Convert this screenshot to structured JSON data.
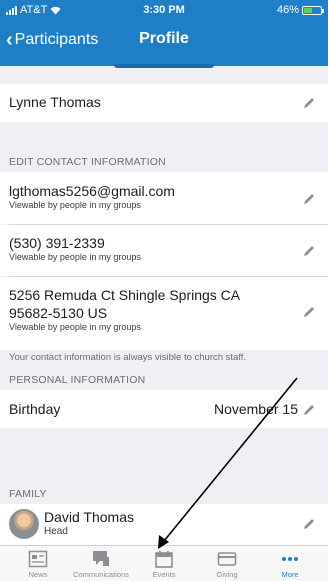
{
  "status_bar": {
    "carrier": "AT&T",
    "time": "3:30 PM",
    "battery": "46%"
  },
  "nav": {
    "back_label": "Participants",
    "title": "Profile"
  },
  "name_row": {
    "name": "Lynne Thomas"
  },
  "contact": {
    "header": "EDIT CONTACT INFORMATION",
    "email": {
      "value": "lgthomas5256@gmail.com",
      "visibility": "Viewable by people in my groups"
    },
    "phone": {
      "value": "(530) 391-2339",
      "visibility": "Viewable by people in my groups"
    },
    "address": {
      "line1": "5256 Remuda Ct Shingle Springs CA",
      "line2": "95682-5130 US",
      "visibility": "Viewable by people in my groups"
    },
    "note": "Your contact information is always visible to church staff."
  },
  "personal": {
    "header": "PERSONAL INFORMATION",
    "birthday_label": "Birthday",
    "birthday_value": "November 15"
  },
  "family": {
    "header": "FAMILY",
    "member_name": "David Thomas",
    "member_role": "Head"
  },
  "tabs": [
    {
      "label": "News",
      "icon": "news-icon"
    },
    {
      "label": "Communications",
      "icon": "communications-icon"
    },
    {
      "label": "Events",
      "icon": "calendar-icon"
    },
    {
      "label": "Giving",
      "icon": "giving-icon"
    },
    {
      "label": "More",
      "icon": "more-icon"
    }
  ],
  "colors": {
    "accent": "#1e7fc6",
    "background": "#efeff4",
    "annotation_arrow": "#000000"
  }
}
